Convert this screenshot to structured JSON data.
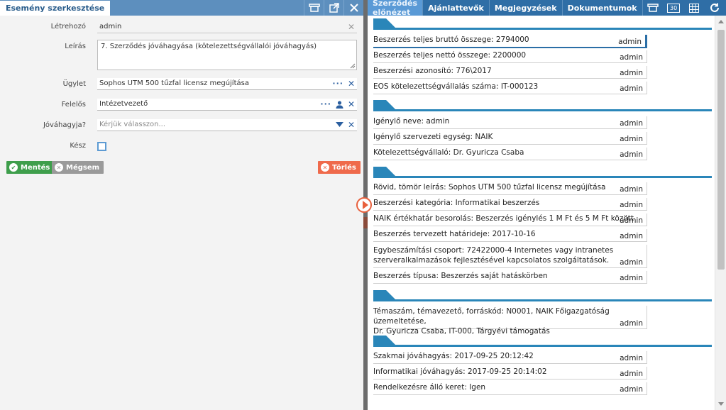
{
  "left_panel": {
    "title": "Esemény szerkesztése",
    "fields": {
      "creator": {
        "label": "Létrehozó",
        "value": "admin"
      },
      "description": {
        "label": "Leírás",
        "value": "7. Szerződés jóváhagyása (kötelezettségvállalói jóváhagyás)"
      },
      "case": {
        "label": "Ügylet",
        "value": "Sophos UTM 500 tűzfal licensz megújítása"
      },
      "responsible": {
        "label": "Felelős",
        "value": "Intézetvezető"
      },
      "approver": {
        "label": "Jóváhagyja?",
        "placeholder": "Kérjük válasszon..."
      },
      "done": {
        "label": "Kész",
        "checked": false
      }
    },
    "buttons": {
      "save": "Mentés",
      "cancel": "Mégsem",
      "delete": "Törlés"
    }
  },
  "right_panel": {
    "tabs": [
      "Szerződés előnézet",
      "Ajánlattevők",
      "Megjegyzések",
      "Dokumentumok"
    ],
    "active_tab": 0,
    "calendar_badge": "30",
    "sections": [
      {
        "items": [
          {
            "text": "Beszerzés teljes bruttó összege: 2794000",
            "user": "admin"
          },
          {
            "text": "Beszerzés teljes nettó összege: 2200000",
            "user": "admin"
          },
          {
            "text": "Beszerzési azonosító: 776\\2017",
            "user": "admin"
          },
          {
            "text": "EOS kötelezettségvállalás száma: IT-000123",
            "user": "admin"
          }
        ]
      },
      {
        "items": [
          {
            "text": "Igénylő neve: admin",
            "user": "admin"
          },
          {
            "text": "Igénylő szervezeti egység: NAIK",
            "user": "admin"
          },
          {
            "text": "Kötelezettségvállaló: Dr. Gyuricza Csaba",
            "user": "admin"
          }
        ]
      },
      {
        "items": [
          {
            "text": "Rövid, tömör leírás: Sophos UTM 500 tűzfal licensz megújítása",
            "user": "admin"
          },
          {
            "text": "Beszerzési kategória: Informatikai beszerzés",
            "user": "admin"
          },
          {
            "text": "NAIK értékhatár besorolás: Beszerzés igénylés 1 M Ft és 5 M Ft között",
            "user": "admin"
          },
          {
            "text": "Beszerzés tervezett határideje: 2017-10-16",
            "user": "admin"
          },
          {
            "text_line1": "Egybeszámítási csoport: 72422000-4 Internetes vagy intranetes",
            "text_line2": "szerveralkalmazások fejlesztésével kapcsolatos szolgáltatások.",
            "user": "admin"
          },
          {
            "text": "Beszerzés típusa: Beszerzés saját hatáskörben",
            "user": "admin"
          }
        ]
      },
      {
        "items": [
          {
            "text_line1": "Témaszám, témavezető, forráskód: N0001, NAIK Főigazgatóság üzemeltetése,",
            "text_line2": "Dr. Gyuricza Csaba, IT-000, Tárgyévi támogatás",
            "user": "admin"
          }
        ]
      },
      {
        "items": [
          {
            "text": "Szakmai jóváhagyás: 2017-09-25 20:12:42",
            "user": "admin"
          },
          {
            "text": "Informatikai jóváhagyás: 2017-09-25 20:14:02",
            "user": "admin"
          },
          {
            "text": "Rendelkezésre álló keret: Igen",
            "user": "admin"
          }
        ]
      }
    ]
  },
  "colors": {
    "left_header": "#5d8fbe",
    "right_header": "#2f6ea6",
    "section_accent": "#2a86b9",
    "save": "#3e9e4b",
    "cancel": "#9a9a9a",
    "delete": "#ef6a4b"
  }
}
